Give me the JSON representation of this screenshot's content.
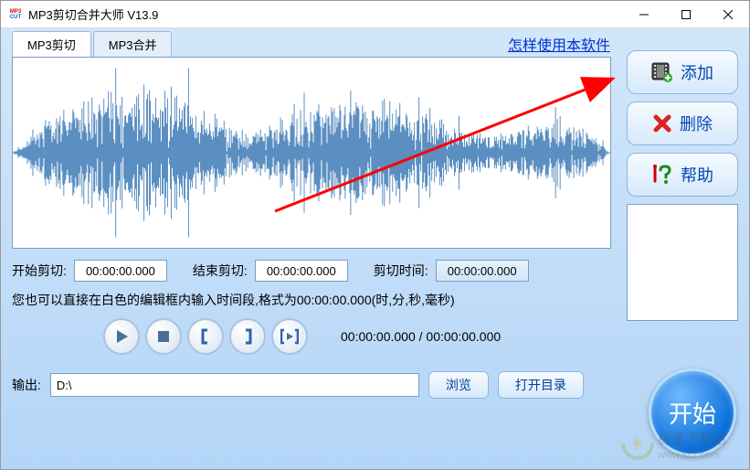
{
  "window": {
    "title": "MP3剪切合并大师 V13.9"
  },
  "tabs": {
    "cut": "MP3剪切",
    "merge": "MP3合并"
  },
  "help_link": "怎样使用本软件",
  "side": {
    "add": "添加",
    "delete": "删除",
    "help": "帮助"
  },
  "time": {
    "start_label": "开始剪切:",
    "start_value": "00:00:00.000",
    "end_label": "结束剪切:",
    "end_value": "00:00:00.000",
    "duration_label": "剪切时间:",
    "duration_value": "00:00:00.000"
  },
  "hint": "您也可以直接在白色的编辑框内输入时间段,格式为00:00:00.000(时,分,秒,毫秒)",
  "progress": "00:00:00.000 / 00:00:00.000",
  "output": {
    "label": "输出:",
    "value": "D:\\",
    "browse": "浏览",
    "open": "打开目录"
  },
  "start": "开始",
  "watermark_text": "极速下载站",
  "watermark_url": "www.xz7.com"
}
